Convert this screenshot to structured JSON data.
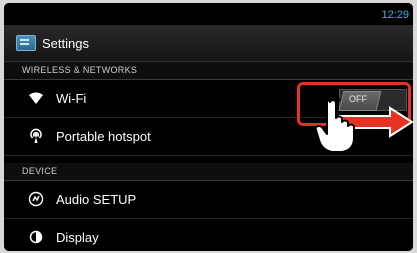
{
  "status_bar": {
    "time": "12:29"
  },
  "action_bar": {
    "title": "Settings",
    "icon": "settings-app-icon"
  },
  "sections": [
    {
      "header": "WIRELESS & NETWORKS",
      "items": [
        {
          "label": "Wi-Fi",
          "icon": "wifi-icon",
          "toggle": "OFF"
        },
        {
          "label": "Portable hotspot",
          "icon": "hotspot-icon"
        }
      ]
    },
    {
      "header": "DEVICE",
      "items": [
        {
          "label": "Audio SETUP",
          "icon": "audio-setup-icon"
        },
        {
          "label": "Display",
          "icon": "display-icon"
        }
      ]
    }
  ],
  "annotation": {
    "gesture": "hand-tap-swipe-right",
    "highlight_color": "#e53223",
    "arrow_color": "#e53223"
  },
  "colors": {
    "accent": "#33b5e5",
    "background": "#000000",
    "text": "#ffffff"
  }
}
